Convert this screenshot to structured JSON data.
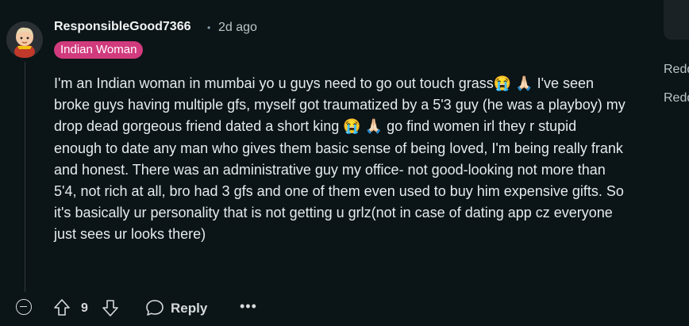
{
  "comment": {
    "username": "ResponsibleGood7366",
    "separator": "•",
    "timestamp": "2d ago",
    "flair": "Indian Woman",
    "body": "I'm an Indian woman in mumbai yo u guys need to go out touch grass😭 🙏🏻 I've seen broke guys having multiple gfs, myself got traumatized by a 5'3 guy (he was a playboy) my drop dead gorgeous friend dated a short king 😭 🙏🏻 go find women irl they r stupid enough to date any man who gives them basic sense of being loved, I'm being really frank and honest. There was an administrative guy my office- not good-looking not more than 5'4, not rich at all, bro had 3 gfs and one of them even used to buy him expensive gifts. So it's basically ur personality that is not getting u grlz(not in case of dating app cz everyone just sees ur looks there)"
  },
  "actions": {
    "vote_count": "9",
    "reply_label": "Reply",
    "more_label": "•••"
  },
  "sidebar": {
    "link1": "Redd",
    "link2": "Redd"
  },
  "icons": {
    "avatar": "avatar-icon",
    "collapse": "collapse-minus-icon",
    "upvote": "upvote-arrow-icon",
    "downvote": "downvote-arrow-icon",
    "reply": "comment-bubble-icon",
    "more": "more-options-icon"
  },
  "colors": {
    "background": "#0b1416",
    "flair": "#d13b7e",
    "text": "#e5ebee"
  }
}
